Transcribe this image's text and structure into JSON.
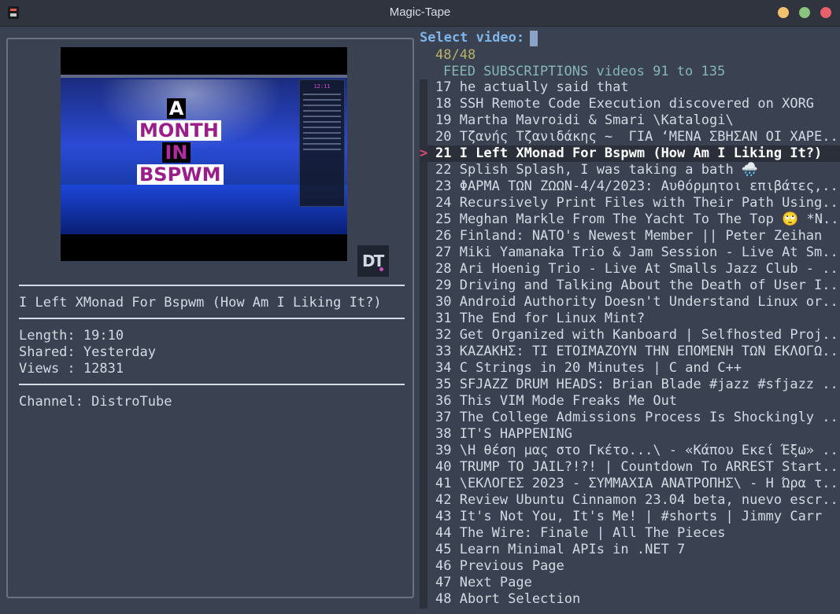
{
  "window": {
    "title": "Magic-Tape"
  },
  "preview": {
    "thumbnail_words": [
      "A",
      "MONTH",
      "IN",
      "BSPWM"
    ],
    "thumbnail_clock": "12:11",
    "video_title": "I Left XMonad For Bspwm (How Am I Liking It?)",
    "length": "Length: 19:10",
    "shared": "Shared: Yesterday",
    "views": "Views : 12831",
    "channel": "Channel: DistroTube"
  },
  "selector": {
    "prompt": "Select video:",
    "count": "48/48",
    "header": "FEED SUBSCRIPTIONS videos 91 to 135",
    "selected_marker": ">",
    "items": [
      "17 he actually said that",
      "18 SSH Remote Code Execution discovered on XORG",
      "19 Martha Mavroidi & Smari \\Katalogi\\",
      "20 Τζανής Τζανιδάκης ~  ΓΙΑ ‘ΜΕΝΑ ΣΒΗΣΑΝ ΟΙ ΧΑΡΕ..",
      "21 I Left XMonad For Bspwm (How Am I Liking It?)",
      "22 Splish Splash, I was taking a bath 🌧️",
      "23 ΦΑΡΜΑ ΤΩΝ ΖΩΩΝ-4/4/2023: Αυθόρμητοι επιβάτες,..",
      "24 Recursively Print Files with Their Path Using..",
      "25 Meghan Markle From The Yacht To The Top 🙄 *N..",
      "26 Finland: NATO's Newest Member || Peter Zeihan",
      "27 Miki Yamanaka Trio & Jam Session - Live At Sm..",
      "28 Ari Hoenig Trio - Live At Smalls Jazz Club - ..",
      "29 Driving and Talking About the Death of User I..",
      "30 Android Authority Doesn't Understand Linux or..",
      "31 The End for Linux Mint?",
      "32 Get Organized with Kanboard | Selfhosted Proj..",
      "33 ΚΑΖΑΚΗΣ: ΤΙ ΕΤΟΙΜΑΖΟΥΝ ΤΗΝ ΕΠΟΜΕΝΗ ΤΩΝ ΕΚΛΟΓΩ..",
      "34 C Strings in 20 Minutes | C and C++",
      "35 SFJAZZ DRUM HEADS: Brian Blade #jazz #sfjazz ..",
      "36 This VIM Mode Freaks Me Out",
      "37 The College Admissions Process Is Shockingly ..",
      "38 IT'S HAPPENING",
      "39 \\Η θέση μας στο Γκέτο...\\ - «Κάπου Εκεί Έξω» ..",
      "40 TRUMP TO JAIL?!?! | Countdown To ARREST Start..",
      "41 \\ΕΚΛΟΓΕΣ 2023 - ΣΥΜΜΑΧΙΑ ΑΝΑΤΡΟΠΗΣ\\ - Η Ώρα τ..",
      "42 Review Ubuntu Cinnamon 23.04 beta, nuevo escr..",
      "43 It's Not You, It's Me! | #shorts | Jimmy Carr",
      "44 The Wire: Finale | All The Pieces",
      "45 Learn Minimal APIs in .NET 7",
      "46 Previous Page",
      "47 Next Page",
      "48 Abort Selection"
    ],
    "selected_index": 4
  },
  "colors": {
    "background": "#3a4150",
    "prompt": "#7fb5ea",
    "count": "#b7b268",
    "header": "#86b7b4",
    "marker": "#e04a6f"
  }
}
